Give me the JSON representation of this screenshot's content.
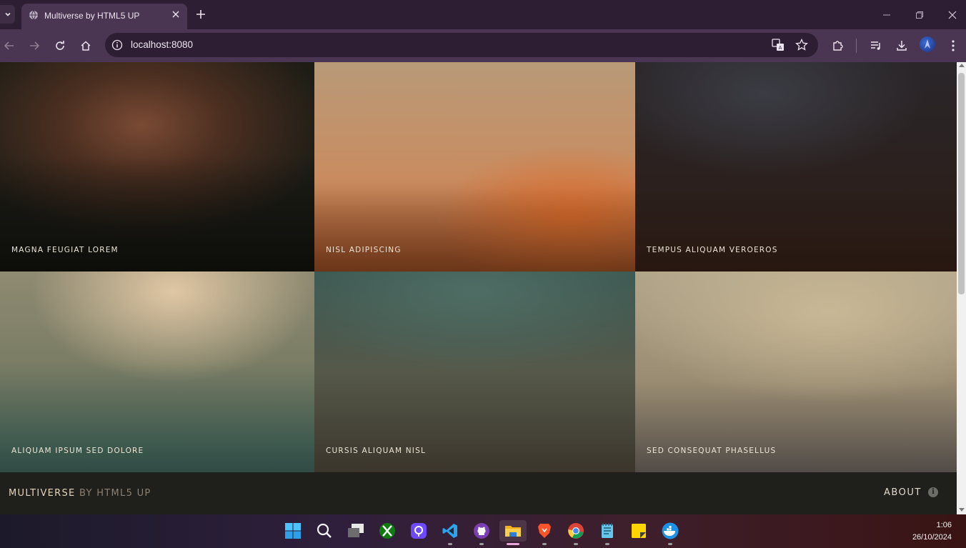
{
  "browser": {
    "tab_title": "Multiverse by HTML5 UP",
    "url": "localhost:8080"
  },
  "gallery": {
    "items": [
      {
        "caption": "Magna feugiat lorem"
      },
      {
        "caption": "Nisl adipiscing"
      },
      {
        "caption": "Tempus aliquam veroeros"
      },
      {
        "caption": "Aliquam ipsum sed dolore"
      },
      {
        "caption": "Cursis aliquam nisl"
      },
      {
        "caption": "Sed consequat phasellus"
      }
    ]
  },
  "footer": {
    "brand_main": "Multiverse",
    "brand_sub": "by HTML5 UP",
    "about": "About"
  },
  "taskbar": {
    "apps": [
      "windows-start",
      "search",
      "task-view",
      "xbox",
      "proton-pass",
      "vscode",
      "github-desktop",
      "file-explorer",
      "brave",
      "chrome",
      "notepad",
      "sticky-notes",
      "docker"
    ],
    "time": "1:06",
    "date": "26/10/2024"
  },
  "colors": {
    "chrome_dark": "#2d1e33",
    "chrome_toolbar": "#4a3552",
    "page_bg": "#242422",
    "caption": "#ece5d4"
  }
}
